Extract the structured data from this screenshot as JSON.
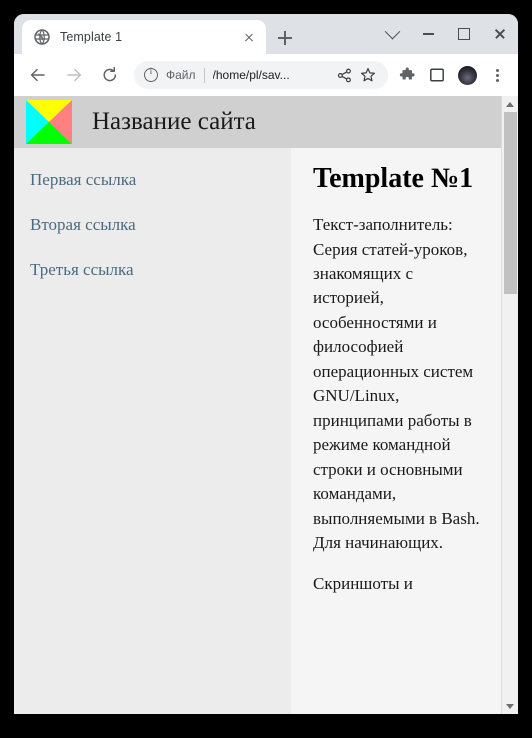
{
  "browser": {
    "tab": {
      "title": "Template 1",
      "favicon_icon": "globe-icon",
      "close_icon": "close-icon"
    },
    "new_tab_icon": "plus-icon",
    "window_controls": {
      "tab_search_icon": "chevron-down-icon",
      "minimize_icon": "minimize-icon",
      "maximize_icon": "maximize-icon",
      "close_icon": "close-icon"
    },
    "toolbar": {
      "back_icon": "arrow-left-icon",
      "forward_icon": "arrow-right-icon",
      "reload_icon": "reload-icon",
      "site_info_icon": "info-circle-icon",
      "scheme_label": "Файл",
      "url": "/home/pl/sav...",
      "share_icon": "share-icon",
      "bookmark_icon": "star-icon",
      "extensions_icon": "puzzle-piece-icon",
      "side_panel_icon": "side-panel-icon",
      "profile_icon": "avatar-icon",
      "menu_icon": "three-dots-icon"
    }
  },
  "page": {
    "header": {
      "logo_icon": "four-triangle-logo-icon",
      "logo_colors": {
        "top": "#ffff00",
        "left": "#00ffff",
        "right": "#ff8080",
        "bottom": "#00ff00"
      },
      "title": "Название сайта",
      "background": "#d0d0d0"
    },
    "sidebar": {
      "background": "#ececec",
      "link_color": "#4a6b80",
      "links": [
        {
          "label": "Первая ссылка"
        },
        {
          "label": "Вторая ссылка"
        },
        {
          "label": "Третья ссылка"
        }
      ]
    },
    "content": {
      "background": "#f5f5f5",
      "title": "Template №1",
      "paragraphs": [
        "Текст-заполнитель: Серия статей-уроков, знакомящих с историей, особенностями и философией операционных систем GNU/Linux, принципами работы в режиме командной строки и основными командами, выполняемыми в Bash. Для начинающих.",
        "Скриншоты и"
      ]
    },
    "scrollbar": {
      "up_arrow_icon": "triangle-up-icon",
      "down_arrow_icon": "triangle-down-icon",
      "thumb_color": "#c1c1c1",
      "track_color": "#f1f1f1"
    }
  }
}
